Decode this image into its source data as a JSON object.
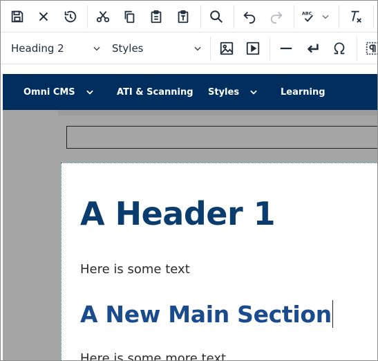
{
  "toolbar": {
    "row1": [
      {
        "name": "save-button",
        "icon": "save-icon"
      },
      {
        "name": "close-button",
        "icon": "close-icon"
      },
      {
        "name": "restore-draft-button",
        "icon": "restore-draft-icon"
      },
      {
        "name": "cut-button",
        "icon": "cut-icon"
      },
      {
        "name": "copy-button",
        "icon": "copy-icon"
      },
      {
        "name": "paste-button",
        "icon": "paste-icon"
      },
      {
        "name": "paste-text-button",
        "icon": "paste-text-icon"
      },
      {
        "name": "search-button",
        "icon": "search-icon"
      },
      {
        "name": "undo-button",
        "icon": "undo-icon"
      },
      {
        "name": "redo-button",
        "icon": "redo-icon"
      },
      {
        "name": "spellcheck-button",
        "icon": "spellcheck-icon"
      },
      {
        "name": "remove-format-button",
        "icon": "remove-format-icon"
      }
    ],
    "block_format": {
      "value": "Heading 2"
    },
    "styles_select": {
      "value": "Styles"
    },
    "spellcheck_label": "ABC",
    "row2": [
      {
        "name": "insert-image-button",
        "icon": "image-icon"
      },
      {
        "name": "insert-media-button",
        "icon": "media-icon"
      },
      {
        "name": "horizontal-rule-button",
        "icon": "horizontal-rule-icon"
      },
      {
        "name": "line-break-button",
        "icon": "line-break-icon"
      },
      {
        "name": "special-char-button",
        "icon": "omega-icon"
      },
      {
        "name": "show-blocks-button",
        "icon": "paragraph-icon"
      }
    ]
  },
  "nav": {
    "items": [
      {
        "label": "Omni CMS",
        "has_dropdown": true
      },
      {
        "label": "ATI & Scanning",
        "has_dropdown": false
      },
      {
        "label": "Styles",
        "has_dropdown": true
      },
      {
        "label": "Learning",
        "has_dropdown": false
      }
    ]
  },
  "content": {
    "heading1": "A Header 1",
    "paragraph1": "Here is some text",
    "heading2": "A New Main Section",
    "paragraph2": "Here is some more text"
  },
  "colors": {
    "navbar": "#002f5f",
    "heading1": "#0b3c6e",
    "heading2": "#1a4b8c",
    "editor_background": "#a5a5a5"
  }
}
